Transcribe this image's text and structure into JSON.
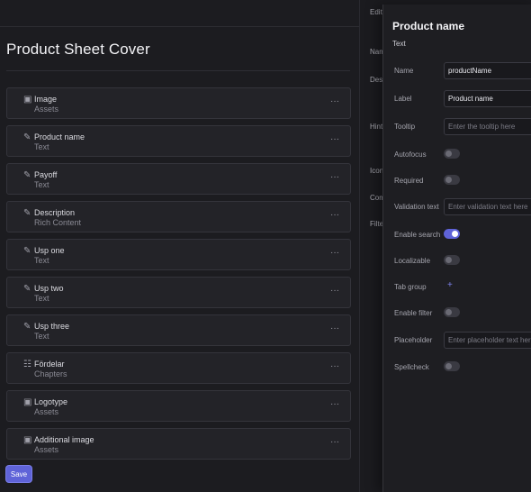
{
  "page": {
    "title": "Product Sheet Cover",
    "save_label": "Save"
  },
  "fields": [
    {
      "name": "Image",
      "type": "Assets",
      "icon": "folder-icon"
    },
    {
      "name": "Product name",
      "type": "Text",
      "icon": "pencil-icon"
    },
    {
      "name": "Payoff",
      "type": "Text",
      "icon": "pencil-icon"
    },
    {
      "name": "Description",
      "type": "Rich Content",
      "icon": "pencil-icon"
    },
    {
      "name": "Usp one",
      "type": "Text",
      "icon": "pencil-icon"
    },
    {
      "name": "Usp two",
      "type": "Text",
      "icon": "pencil-icon"
    },
    {
      "name": "Usp three",
      "type": "Text",
      "icon": "pencil-icon"
    },
    {
      "name": "Fördelar",
      "type": "Chapters",
      "icon": "chapters-icon"
    },
    {
      "name": "Logotype",
      "type": "Assets",
      "icon": "folder-icon"
    },
    {
      "name": "Additional image",
      "type": "Assets",
      "icon": "folder-icon"
    }
  ],
  "more_glyph": "···",
  "middle": {
    "edit": "Edit",
    "name": "Nam",
    "desc": "Desc",
    "hint": "Hint",
    "icon": "Icon",
    "com": "Com",
    "filter": "Filte"
  },
  "panel": {
    "title": "Product name",
    "subtitle": "Text",
    "name_label": "Name",
    "name_value": "productName",
    "label_label": "Label",
    "label_value": "Product name",
    "tooltip_label": "Tooltip",
    "tooltip_placeholder": "Enter the tooltip here",
    "autofocus_label": "Autofocus",
    "autofocus_on": false,
    "required_label": "Required",
    "required_on": false,
    "validation_label": "Validation text",
    "validation_placeholder": "Enter validation text here",
    "enable_search_label": "Enable search",
    "enable_search_on": true,
    "localizable_label": "Localizable",
    "localizable_on": false,
    "tab_group_label": "Tab group",
    "tab_group_add": "+",
    "enable_filter_label": "Enable filter",
    "enable_filter_on": false,
    "placeholder_label": "Placeholder",
    "placeholder_placeholder": "Enter placeholder text here",
    "spellcheck_label": "Spellcheck",
    "spellcheck_on": false
  },
  "colors": {
    "accent": "#5f63d8",
    "background": "#1c1c20",
    "card": "#232328"
  }
}
